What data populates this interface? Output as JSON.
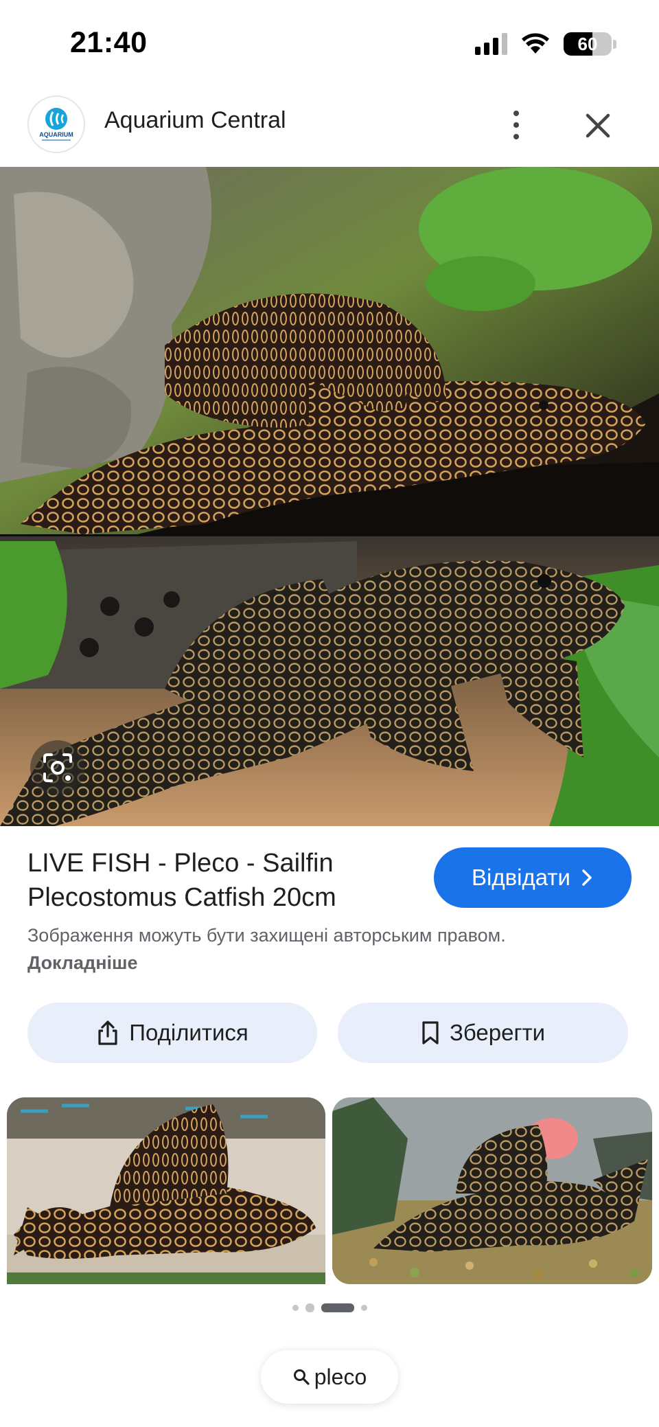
{
  "status_bar": {
    "time": "21:40",
    "battery_level": "60",
    "battery_fraction": 0.6,
    "icons": [
      "signal-icon",
      "wifi-icon",
      "battery-icon"
    ]
  },
  "header": {
    "site_name": "Aquarium Central",
    "logo_text": "AQUARIUM",
    "icons": [
      "more-vert-icon",
      "close-icon"
    ]
  },
  "result": {
    "title": "LIVE FISH - Pleco - Sailfin Plecostomus Catfish 20cm",
    "visit_label": "Відвідати",
    "copyright_text": "Зображення можуть бути захищені авторським правом.",
    "copyright_link": "Докладніше"
  },
  "actions": {
    "share_label": "Поділитися",
    "save_label": "Зберегти"
  },
  "pager": {
    "count": 4,
    "active_index": 2
  },
  "search": {
    "query": "pleco"
  },
  "colors": {
    "accent": "#1a73e8",
    "chip_bg": "#e8effa",
    "muted_text": "#5f6368"
  }
}
